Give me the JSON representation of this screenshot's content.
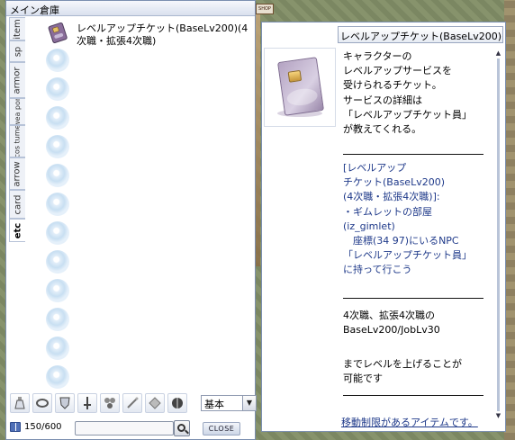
{
  "background": {
    "shop_sign": "SHOP"
  },
  "storage": {
    "title": "メイン倉庫",
    "tabs": [
      "item",
      "sp",
      "armor",
      "wea pon",
      "cos tume",
      "arrow",
      "card",
      "etc"
    ],
    "active_tab": "etc",
    "items": [
      {
        "name": "レベルアップチケット(BaseLv200)(4次職・拡張4次職)",
        "icon": "ticket-icon"
      }
    ],
    "empty_slot_count": 12,
    "toolbar": {
      "tools": [
        "potion-icon",
        "ring-icon",
        "armor-icon",
        "sword-icon",
        "box-icon",
        "wand-icon",
        "card-icon",
        "ball-icon"
      ],
      "sort_value": "基本"
    },
    "footer": {
      "count": "150/600",
      "search_value": "",
      "close_label": "CLOSE"
    }
  },
  "description": {
    "title": "レベルアップチケット(BaseLv200)(4次職・拡張4次職)",
    "para1": "キャラクターの\nレベルアップサービスを\n受けられるチケット。\nサービスの詳細は\n「レベルアップチケット員」\nが教えてくれる。",
    "para2": "[レベルアップ\nチケット(BaseLv200)\n(4次職・拡張4次職)]:\n・ギムレットの部屋\n(iz_gimlet)\n　座標(34 97)にいるNPC\n「レベルアップチケット員」\nに持って行こう",
    "para3": "4次職、拡張4次職の\nBaseLv200/JobLv30",
    "para4": "までレベルを上げることが\n可能です",
    "move_restriction": "移動制限があるアイテムです。",
    "colors": {
      "link": "#1f3a8a",
      "window_border": "#7b8fb0"
    }
  }
}
